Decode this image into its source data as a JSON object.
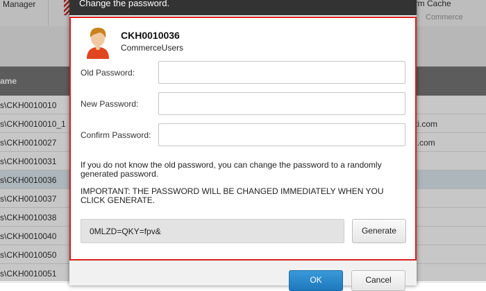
{
  "background": {
    "toolbar": {
      "manager_label": "Manager",
      "term_cache_label": "erm Cache",
      "commerce_label": "Commerce"
    },
    "table": {
      "header_label": "ame",
      "rows": [
        {
          "name": "s\\CKH0010010",
          "extra": ""
        },
        {
          "name": "s\\CKH0010010_1",
          "extra": "ti.com"
        },
        {
          "name": "s\\CKH0010027",
          "extra": "i.com"
        },
        {
          "name": "s\\CKH0010031",
          "extra": ""
        },
        {
          "name": "s\\CKH0010036",
          "extra": ""
        },
        {
          "name": "s\\CKH0010037",
          "extra": ""
        },
        {
          "name": "s\\CKH0010038",
          "extra": ""
        },
        {
          "name": "s\\CKH0010040",
          "extra": ""
        },
        {
          "name": "s\\CKH0010050",
          "extra": ""
        },
        {
          "name": "s\\CKH0010051",
          "extra": ""
        }
      ],
      "selected_row": 4
    }
  },
  "dialog": {
    "title": "Change the password.",
    "user": {
      "name": "CKH0010036",
      "group": "CommerceUsers",
      "avatar_icon": "user-avatar-icon"
    },
    "fields": {
      "old_password_label": "Old Password:",
      "new_password_label": "New Password:",
      "confirm_password_label": "Confirm Password:",
      "old_password_value": "",
      "new_password_value": "",
      "confirm_password_value": ""
    },
    "info_text": "If you do not know the old password, you can change the password to a randomly generated password.",
    "warning_text": "IMPORTANT: THE PASSWORD WILL BE CHANGED IMMEDIATELY WHEN YOU CLICK GENERATE.",
    "generated_password": "0MLZD=QKY=fpv&",
    "generate_label": "Generate",
    "ok_label": "OK",
    "cancel_label": "Cancel",
    "colors": {
      "highlight_border": "#d81f1f",
      "ok_button": "#1e78bd",
      "title_bar": "#333333"
    }
  }
}
